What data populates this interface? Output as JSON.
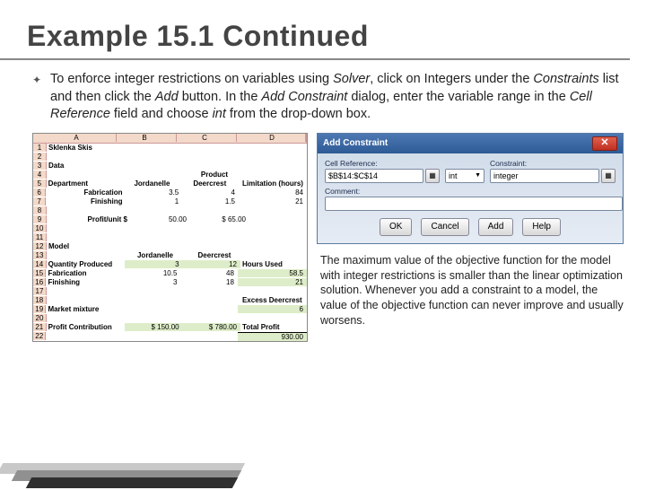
{
  "title": "Example 15.1 Continued",
  "intro": "To enforce integer restrictions on variables using Solver, click on Integers under the Constraints list and then click the Add button. In the Add Constraint dialog, enter the variable range in the Cell Reference field and choose int from the drop-down box.",
  "caption": "The maximum value of the objective function for the model with integer restrictions is smaller than the linear optimization solution. Whenever you add a constraint to a model, the value of the objective function can never improve and usually worsens.",
  "spreadsheet": {
    "cols": [
      "",
      "A",
      "B",
      "C",
      "D"
    ],
    "r1": {
      "a": "Sklenka Skis"
    },
    "r3": {
      "a": "Data"
    },
    "r4": {
      "c": "Product"
    },
    "r5": {
      "a": "Department",
      "b": "Jordanelle",
      "c": "Deercrest",
      "d": "Limitation (hours)"
    },
    "r6": {
      "a": "Fabrication",
      "b": "3.5",
      "c": "4",
      "d": "84"
    },
    "r7": {
      "a": "Finishing",
      "b": "1",
      "c": "1.5",
      "d": "21"
    },
    "r9": {
      "a": "Profit/unit $",
      "b": "50.00",
      "c": "$ 65.00"
    },
    "r12": {
      "a": "Model"
    },
    "r13": {
      "b": "Jordanelle",
      "c": "Deercrest"
    },
    "r14": {
      "a": "Quantity Produced",
      "b": "3",
      "c": "12",
      "d": "Hours Used"
    },
    "r15": {
      "a": "Fabrication",
      "b": "10.5",
      "c": "48",
      "d": "58.5"
    },
    "r16": {
      "a": "Finishing",
      "b": "3",
      "c": "18",
      "d": "21"
    },
    "r18": {
      "d": "Excess Deercrest"
    },
    "r19": {
      "a": "Market mixture",
      "d": "6"
    },
    "r21_a": "Profit Contribution",
    "r21_b": "$   150.00",
    "r21_c": "$ 780.00",
    "r21_d_lbl": "Total Profit",
    "r22_d": "930.00"
  },
  "dialog": {
    "title": "Add Constraint",
    "cellref_lbl": "Cell Reference:",
    "cellref_val": "$B$14:$C$14",
    "op": "int",
    "constraint_lbl": "Constraint:",
    "constraint_val": "integer",
    "comment_lbl": "Comment:",
    "ok": "OK",
    "cancel": "Cancel",
    "add": "Add",
    "help": "Help"
  }
}
